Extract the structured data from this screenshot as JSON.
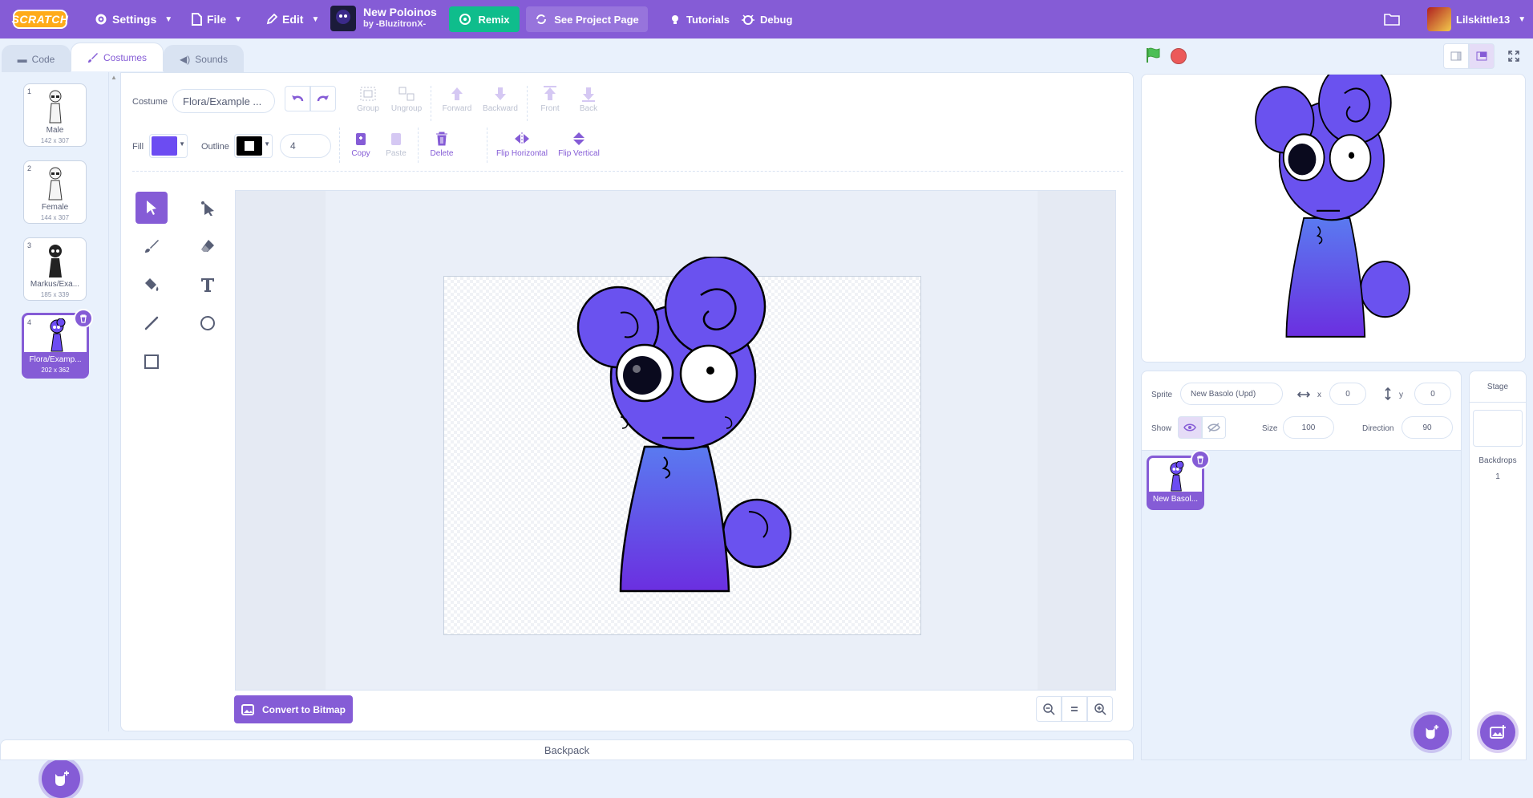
{
  "menu": {
    "logo": "SCRATCH",
    "settings": "Settings",
    "file": "File",
    "edit": "Edit",
    "project_title": "New Poloinos",
    "project_author": "by -BluzitronX-",
    "remix": "Remix",
    "see_project": "See Project Page",
    "tutorials": "Tutorials",
    "debug": "Debug",
    "username": "Lilskittle13"
  },
  "tabs": {
    "code": "Code",
    "costumes": "Costumes",
    "sounds": "Sounds"
  },
  "costumes": [
    {
      "num": "1",
      "name": "Male",
      "size": "142 x 307"
    },
    {
      "num": "2",
      "name": "Female",
      "size": "144 x 307"
    },
    {
      "num": "3",
      "name": "Markus/Exa...",
      "size": "185 x 339"
    },
    {
      "num": "4",
      "name": "Flora/Examp...",
      "size": "202 x 362"
    }
  ],
  "editor": {
    "costume_label": "Costume",
    "costume_name": "Flora/Example ...",
    "group": "Group",
    "ungroup": "Ungroup",
    "forward": "Forward",
    "backward": "Backward",
    "front": "Front",
    "back": "Back",
    "fill_label": "Fill",
    "outline_label": "Outline",
    "outline_width": "4",
    "copy": "Copy",
    "paste": "Paste",
    "delete": "Delete",
    "flip_h": "Flip Horizontal",
    "flip_v": "Flip Vertical",
    "convert": "Convert to Bitmap",
    "fill_color": "#6c4cf2",
    "outline_color": "#000000"
  },
  "backpack": "Backpack",
  "sprite": {
    "label": "Sprite",
    "name": "New Basolo (Upd)",
    "x_label": "x",
    "x": "0",
    "y_label": "y",
    "y": "0",
    "show_label": "Show",
    "size_label": "Size",
    "size": "100",
    "direction_label": "Direction",
    "direction": "90",
    "tile_name": "New Basol..."
  },
  "stage_pane": {
    "title": "Stage",
    "backdrops_label": "Backdrops",
    "backdrops_count": "1"
  },
  "colors": {
    "accent": "#855cd6",
    "green": "#0fbd8c",
    "menubar": "#855cd6"
  }
}
